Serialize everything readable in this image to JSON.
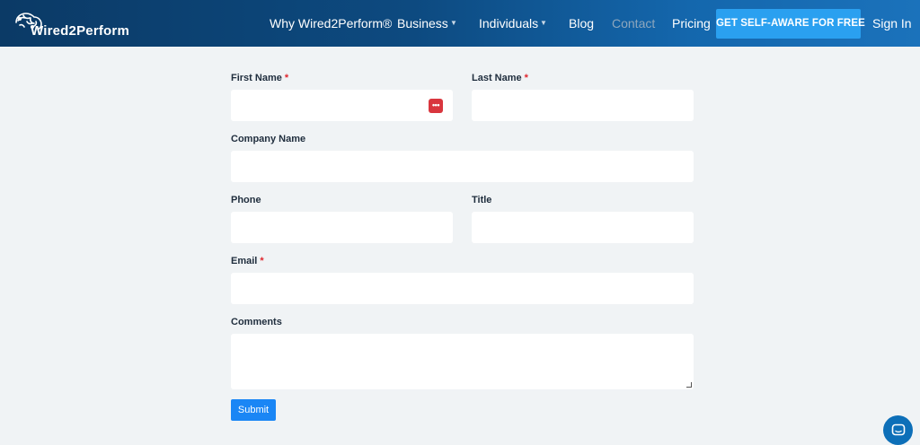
{
  "header": {
    "logo_text": "Wired2Perform",
    "nav": [
      {
        "label": "Why Wired2Perform®"
      },
      {
        "label": "Business"
      },
      {
        "label": "Individuals"
      },
      {
        "label": "Blog"
      },
      {
        "label": "Contact"
      },
      {
        "label": "Pricing"
      }
    ],
    "cta_label": "GET SELF-AWARE FOR FREE",
    "sign_in": "Sign In"
  },
  "form": {
    "first_name": {
      "label": "First Name",
      "required_mark": "*",
      "value": ""
    },
    "last_name": {
      "label": "Last Name",
      "required_mark": "*",
      "value": ""
    },
    "company_name": {
      "label": "Company Name",
      "value": ""
    },
    "phone": {
      "label": "Phone",
      "value": ""
    },
    "title": {
      "label": "Title",
      "value": ""
    },
    "email": {
      "label": "Email",
      "required_mark": "*",
      "value": ""
    },
    "comments": {
      "label": "Comments",
      "value": ""
    },
    "submit_label": "Submit"
  },
  "colors": {
    "header_start": "#0b3a66",
    "header_end": "#1b72bb",
    "cta": "#2aa0f0",
    "submit": "#1a86f5",
    "required": "#e0262e",
    "page_bg": "#f0f3f5"
  },
  "icons": {
    "logo": "brain-icon",
    "password_manager": "password-manager-icon",
    "chat": "chat-bubble-icon"
  }
}
